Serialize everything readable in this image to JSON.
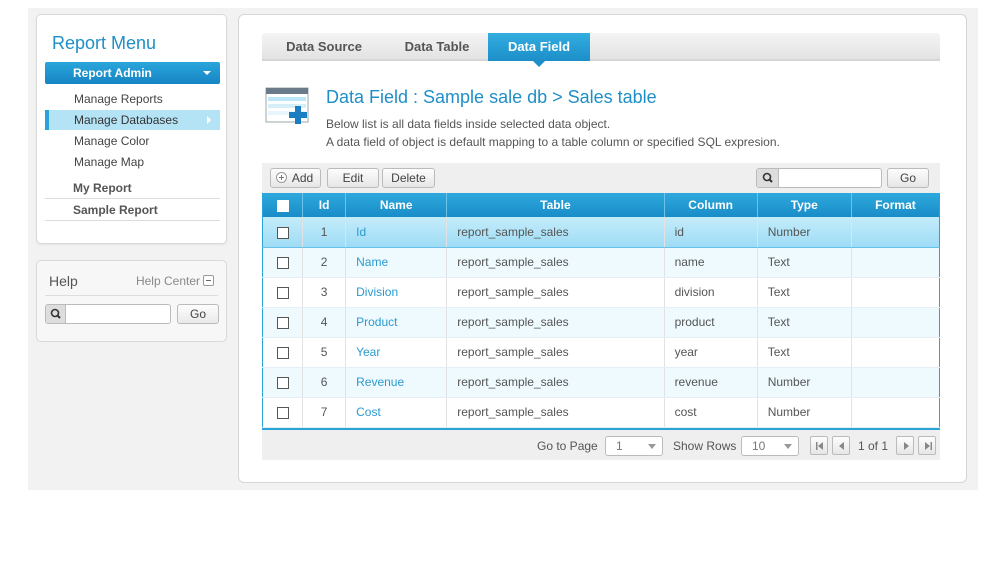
{
  "menu": {
    "title": "Report Menu",
    "section": "Report Admin",
    "sub_items": [
      "Manage Reports",
      "Manage Databases",
      "Manage Color",
      "Manage Map"
    ],
    "top_items": [
      "My Report",
      "Sample Report"
    ]
  },
  "help": {
    "title": "Help",
    "center_link": "Help Center",
    "search_placeholder": "",
    "go_label": "Go"
  },
  "tabs": [
    "Data Source",
    "Data Table",
    "Data Field"
  ],
  "active_tab": "Data Field",
  "page": {
    "title": "Data Field : Sample sale db > Sales table",
    "desc_line1": "Below list is all data fields inside selected data object.",
    "desc_line2": "A data field of object is default mapping to a table column or specified SQL expresion."
  },
  "toolbar": {
    "add_label": "Add",
    "edit_label": "Edit",
    "delete_label": "Delete",
    "search_placeholder": "",
    "go_label": "Go"
  },
  "table": {
    "columns": [
      "Id",
      "Name",
      "Table",
      "Column",
      "Type",
      "Format"
    ],
    "rows": [
      {
        "id": "1",
        "name": "Id",
        "table": "report_sample_sales",
        "column": "id",
        "type": "Number",
        "format": ""
      },
      {
        "id": "2",
        "name": "Name",
        "table": "report_sample_sales",
        "column": "name",
        "type": "Text",
        "format": ""
      },
      {
        "id": "3",
        "name": "Division",
        "table": "report_sample_sales",
        "column": "division",
        "type": "Text",
        "format": ""
      },
      {
        "id": "4",
        "name": "Product",
        "table": "report_sample_sales",
        "column": "product",
        "type": "Text",
        "format": ""
      },
      {
        "id": "5",
        "name": "Year",
        "table": "report_sample_sales",
        "column": "year",
        "type": "Text",
        "format": ""
      },
      {
        "id": "6",
        "name": "Revenue",
        "table": "report_sample_sales",
        "column": "revenue",
        "type": "Number",
        "format": ""
      },
      {
        "id": "7",
        "name": "Cost",
        "table": "report_sample_sales",
        "column": "cost",
        "type": "Number",
        "format": ""
      }
    ],
    "selected_row": 0
  },
  "pager": {
    "goto_label": "Go to Page",
    "page_value": "1",
    "show_rows_label": "Show Rows",
    "rows_value": "10",
    "page_info": "1 of 1"
  },
  "colors": {
    "accent": "#1e8fc8",
    "header_blue": "#2ea9dd",
    "selected_row": "#b5e3f6",
    "even_row": "#eefafe"
  }
}
